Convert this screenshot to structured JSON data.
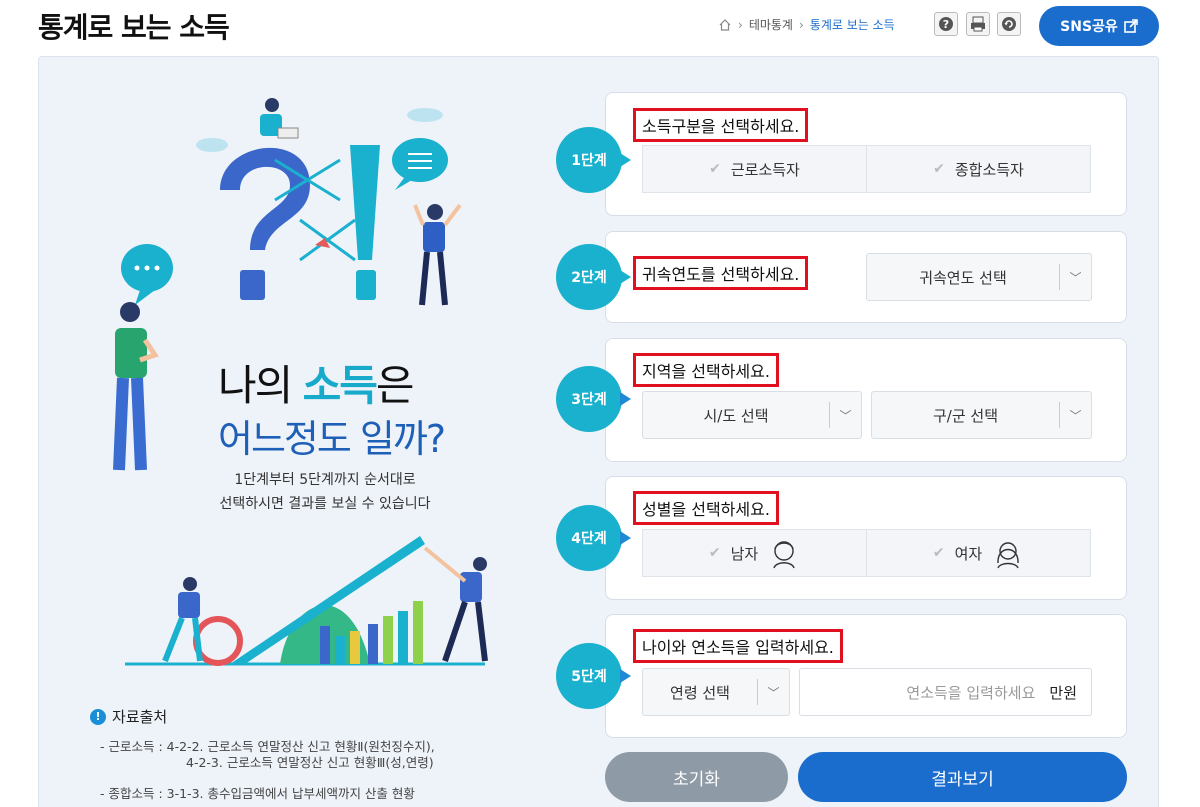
{
  "header": {
    "title": "통계로 보는 소득",
    "breadcrumb": [
      "테마통계",
      "통계로 보는 소득"
    ],
    "sns_label": "SNS공유"
  },
  "intro": {
    "headline_pre": "나의 ",
    "headline_highlight": "소득",
    "headline_post": "은",
    "headline_line2": "어느정도 일까?",
    "desc_line1": "1단계부터 5단계까지 순서대로",
    "desc_line2": "선택하시면 결과를 보실 수 있습니다"
  },
  "source": {
    "title": "자료출처",
    "lines": [
      "- 근로소득 :  4-2-2. 근로소득 연말정산 신고 현황Ⅱ(원천징수지),",
      "4-2-3. 근로소득 연말정산 신고 현황Ⅲ(성,연령)",
      "- 종합소득 :  3-1-3. 총수입금액에서 납부세액까지 산출 현황"
    ]
  },
  "steps": [
    {
      "badge": "1단계",
      "question": "소득구분을 선택하세요.",
      "options": [
        "근로소득자",
        "종합소득자"
      ]
    },
    {
      "badge": "2단계",
      "question": "귀속연도를 선택하세요.",
      "select": "귀속연도 선택"
    },
    {
      "badge": "3단계",
      "question": "지역을 선택하세요.",
      "selects": [
        "시/도 선택",
        "구/군 선택"
      ]
    },
    {
      "badge": "4단계",
      "question": "성별을 선택하세요.",
      "options": [
        "남자",
        "여자"
      ]
    },
    {
      "badge": "5단계",
      "question": "나이와 연소득을 입력하세요.",
      "age_select": "연령 선택",
      "income_placeholder": "연소득을 입력하세요",
      "income_unit": "만원"
    }
  ],
  "actions": {
    "reset": "초기화",
    "result": "결과보기"
  },
  "colors": {
    "accent_blue": "#1a6dcc",
    "teal": "#1ab1cf",
    "highlight_red": "#e01020"
  }
}
